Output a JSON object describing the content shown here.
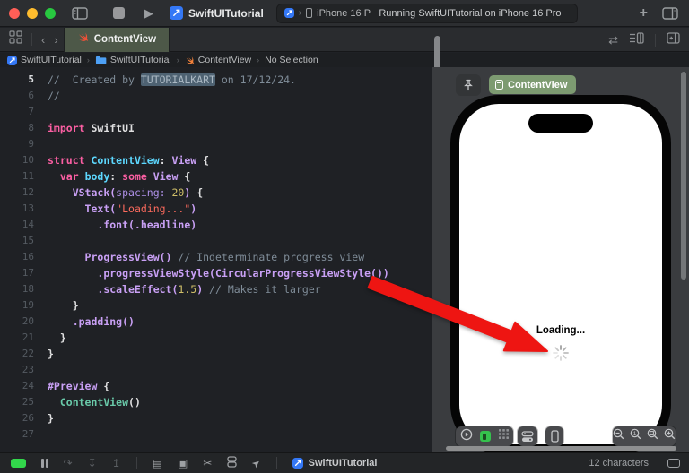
{
  "titlebar": {
    "project": "SwiftUITutorial",
    "device": "iPhone 16 P",
    "status": "Running SwiftUITutorial on iPhone 16 Pro",
    "plus": "+",
    "breadcrumb_chevron": "›"
  },
  "tabbar": {
    "back_chevron": "‹",
    "forward_chevron": "›",
    "tab_label": "ContentView",
    "swap_glyph": "⇄"
  },
  "jumpbar": {
    "chevron": "›",
    "item_project": "SwiftUITutorial",
    "item_folder": "SwiftUITutorial",
    "item_file": "ContentView",
    "item_selection": "No Selection"
  },
  "editor": {
    "lines": [
      {
        "n": 5,
        "cur": true,
        "s": [
          [
            "c",
            "//  Created by "
          ],
          [
            "sel",
            "TUTORIALKART"
          ],
          [
            "c",
            " on 17/12/24."
          ]
        ]
      },
      {
        "n": 6,
        "s": [
          [
            "c",
            "//"
          ]
        ]
      },
      {
        "n": 7,
        "s": []
      },
      {
        "n": 8,
        "s": [
          [
            "k",
            "import"
          ],
          [
            "b",
            " SwiftUI"
          ]
        ]
      },
      {
        "n": 9,
        "s": []
      },
      {
        "n": 10,
        "s": [
          [
            "k",
            "struct"
          ],
          [
            "p",
            " "
          ],
          [
            "d",
            "ContentView"
          ],
          [
            "b",
            ": "
          ],
          [
            "t",
            "View"
          ],
          [
            "b",
            " {"
          ]
        ]
      },
      {
        "n": 11,
        "s": [
          [
            "p",
            "  "
          ],
          [
            "k",
            "var"
          ],
          [
            "p",
            " "
          ],
          [
            "d",
            "body"
          ],
          [
            "b",
            ": "
          ],
          [
            "k",
            "some"
          ],
          [
            "p",
            " "
          ],
          [
            "t",
            "View"
          ],
          [
            "b",
            " {"
          ]
        ]
      },
      {
        "n": 12,
        "s": [
          [
            "p",
            "    "
          ],
          [
            "t",
            "VStack("
          ],
          [
            "t2",
            "spacing:"
          ],
          [
            "p",
            " "
          ],
          [
            "n",
            "20"
          ],
          [
            "t",
            ")"
          ],
          [
            "b",
            " {"
          ]
        ]
      },
      {
        "n": 13,
        "s": [
          [
            "p",
            "      "
          ],
          [
            "t",
            "Text("
          ],
          [
            "s",
            "\"Loading...\""
          ],
          [
            "t",
            ")"
          ]
        ]
      },
      {
        "n": 14,
        "s": [
          [
            "p",
            "        "
          ],
          [
            "t",
            ".font(.headline)"
          ]
        ]
      },
      {
        "n": 15,
        "s": []
      },
      {
        "n": 16,
        "s": [
          [
            "p",
            "      "
          ],
          [
            "t",
            "ProgressView()"
          ],
          [
            "c",
            " // Indeterminate progress view"
          ]
        ]
      },
      {
        "n": 17,
        "s": [
          [
            "p",
            "        "
          ],
          [
            "t",
            ".progressViewStyle(CircularProgressViewStyle())"
          ]
        ]
      },
      {
        "n": 18,
        "s": [
          [
            "p",
            "        "
          ],
          [
            "t",
            ".scaleEffect("
          ],
          [
            "n",
            "1.5"
          ],
          [
            "t",
            ")"
          ],
          [
            "c",
            " // Makes it larger"
          ]
        ]
      },
      {
        "n": 19,
        "s": [
          [
            "b",
            "    }"
          ]
        ]
      },
      {
        "n": 20,
        "s": [
          [
            "p",
            "    "
          ],
          [
            "t",
            ".padding()"
          ]
        ]
      },
      {
        "n": 21,
        "s": [
          [
            "b",
            "  }"
          ]
        ]
      },
      {
        "n": 22,
        "s": [
          [
            "b",
            "}"
          ]
        ]
      },
      {
        "n": 23,
        "s": []
      },
      {
        "n": 24,
        "s": [
          [
            "t",
            "#Preview"
          ],
          [
            "b",
            " {"
          ]
        ]
      },
      {
        "n": 25,
        "s": [
          [
            "p",
            "  "
          ],
          [
            "m",
            "ContentView"
          ],
          [
            "b",
            "()"
          ]
        ]
      },
      {
        "n": 26,
        "s": [
          [
            "b",
            "}"
          ]
        ]
      },
      {
        "n": 27,
        "s": []
      }
    ]
  },
  "canvas": {
    "preview_label": "ContentView",
    "loading_text": "Loading..."
  },
  "statusbar": {
    "project": "SwiftUITutorial",
    "characters": "12 characters"
  },
  "colors": {
    "traffic_red": "#ff5f57",
    "traffic_yellow": "#febc2e",
    "traffic_green": "#28c840",
    "tab_active_bg": "#4d5848",
    "preview_pill_bg": "#7d9b71",
    "swift_orange": "#f05138",
    "app_icon_blue": "#3478f6",
    "arrow_red": "#ee1512",
    "breakpoint_green": "#32d74b"
  }
}
